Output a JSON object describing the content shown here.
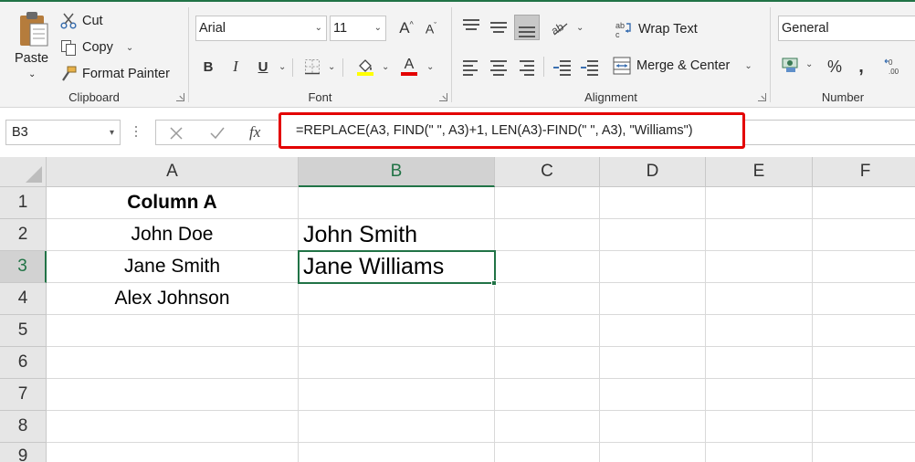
{
  "ribbon": {
    "clipboard": {
      "paste_label": "Paste",
      "cut_label": "Cut",
      "copy_label": "Copy",
      "format_painter_label": "Format Painter",
      "group_label": "Clipboard"
    },
    "font": {
      "font_name": "Arial",
      "font_size": "11",
      "bold": "B",
      "italic": "I",
      "underline": "U",
      "font_color_glyph": "A",
      "group_label": "Font",
      "highlight_color": "#ffff00",
      "font_color": "#e30000"
    },
    "alignment": {
      "wrap_text_label": "Wrap Text",
      "merge_center_label": "Merge & Center",
      "group_label": "Alignment"
    },
    "number": {
      "format_value": "General",
      "percent": "%",
      "comma": ",",
      "group_label": "Number"
    }
  },
  "formula_bar": {
    "name_box": "B3",
    "fx": "fx",
    "formula": "=REPLACE(A3, FIND(\" \", A3)+1, LEN(A3)-FIND(\" \", A3), \"Williams\")"
  },
  "sheet": {
    "columns": [
      "A",
      "B",
      "C",
      "D",
      "E",
      "F"
    ],
    "rows": [
      "1",
      "2",
      "3",
      "4",
      "5",
      "6",
      "7",
      "8",
      "9"
    ],
    "cells": {
      "A1": "Column A",
      "A2": "John Doe",
      "A3": "Jane Smith",
      "A4": "Alex Johnson",
      "B2": "John Smith",
      "B3": "Jane Williams"
    },
    "selected_cell": "B3",
    "accent_color": "#217346",
    "highlight_box_color": "#e30000"
  }
}
